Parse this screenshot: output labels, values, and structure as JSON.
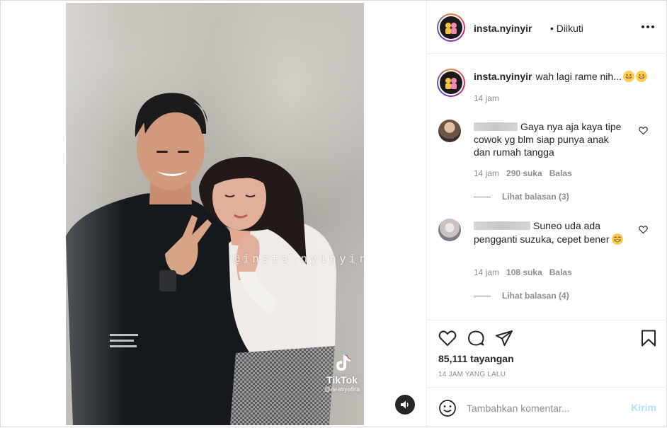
{
  "post": {
    "username": "insta.nyinyir",
    "follow_status": "• Diikuti",
    "more_icon": "more-horizontal-icon",
    "caption": "wah lagi rame nih...",
    "caption_time": "14 jam"
  },
  "media": {
    "watermark": "@insta.nyinyir",
    "tiktok_label": "TikTok",
    "tiktok_user": "@israsyafira",
    "sound_icon": "speaker-icon"
  },
  "comments": [
    {
      "username_hidden": true,
      "text": "Gaya nya aja kaya tipe cowok yg blm siap punya anak dan rumah tangga",
      "time": "14 jam",
      "likes": "290 suka",
      "reply_label": "Balas",
      "view_replies": "Lihat balasan (3)"
    },
    {
      "username_hidden": true,
      "text": "Suneo uda ada pengganti suzuka, cepet bener",
      "time": "14 jam",
      "likes": "108 suka",
      "reply_label": "Balas",
      "view_replies": "Lihat balasan (4)"
    }
  ],
  "actions": {
    "like_icon": "heart-icon",
    "comment_icon": "comment-icon",
    "share_icon": "paper-plane-icon",
    "save_icon": "bookmark-icon"
  },
  "stats": {
    "views": "85,111 tayangan",
    "posted": "14 JAM YANG LALU"
  },
  "composer": {
    "placeholder": "Tambahkan komentar...",
    "post_label": "Kirim",
    "emoji_icon": "smiley-icon"
  },
  "colors": {
    "text": "#262626",
    "muted": "#8e8e8e",
    "border": "#dbdbdb",
    "post_disabled": "#b2dffc"
  }
}
